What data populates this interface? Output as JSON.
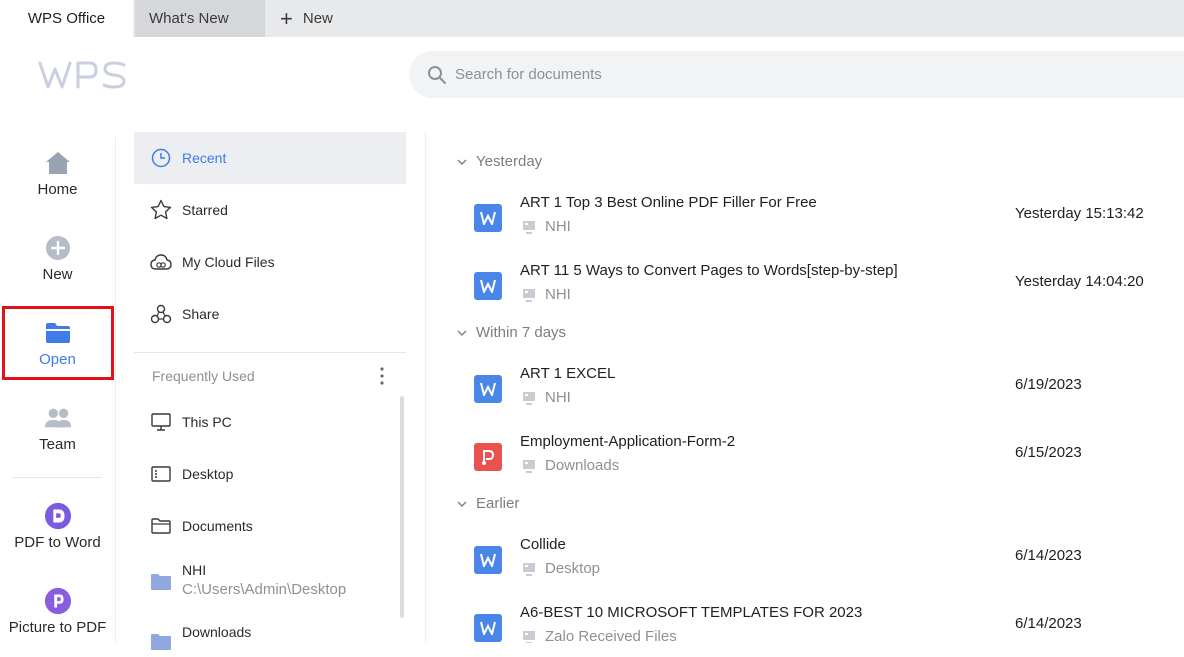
{
  "tabs": {
    "home": "WPS Office",
    "whats_new": "What's New",
    "new": "New"
  },
  "search": {
    "placeholder": "Search for documents"
  },
  "leftnav": [
    {
      "label": "Home",
      "icon": "home-icon"
    },
    {
      "label": "New",
      "icon": "plus-circle-icon"
    },
    {
      "label": "Open",
      "icon": "folder-icon",
      "active": true
    },
    {
      "label": "Team",
      "icon": "team-icon"
    },
    {
      "label": "PDF to Word",
      "icon": "pdf-to-word-icon"
    },
    {
      "label": "Picture to PDF",
      "icon": "picture-to-pdf-icon"
    }
  ],
  "col2": {
    "items": [
      {
        "label": "Recent",
        "icon": "clock-icon",
        "active": true
      },
      {
        "label": "Starred",
        "icon": "star-icon"
      },
      {
        "label": "My Cloud Files",
        "icon": "cloud-icon"
      },
      {
        "label": "Share",
        "icon": "share-icon"
      }
    ],
    "frequently_used_label": "Frequently Used",
    "locations": [
      {
        "label": "This PC",
        "icon": "monitor-icon"
      },
      {
        "label": "Desktop",
        "icon": "desktop-icon"
      },
      {
        "label": "Documents",
        "icon": "folder-outline-icon"
      },
      {
        "label": "NHI",
        "path": "C:\\Users\\Admin\\Desktop",
        "icon": "folder-filled-icon"
      },
      {
        "label": "Downloads",
        "icon": "folder-filled-icon"
      }
    ]
  },
  "groups": [
    {
      "label": "Yesterday"
    },
    {
      "label": "Within 7 days"
    },
    {
      "label": "Earlier"
    }
  ],
  "files": [
    {
      "name": "ART 1 Top 3 Best Online PDF Filler For Free",
      "location": "NHI",
      "date": "Yesterday 15:13:42",
      "type": "word"
    },
    {
      "name": "ART 11 5 Ways to Convert Pages to Words[step-by-step]",
      "location": "NHI",
      "date": "Yesterday 14:04:20",
      "type": "word"
    },
    {
      "name": "ART 1 EXCEL",
      "location": "NHI",
      "date": "6/19/2023",
      "type": "word"
    },
    {
      "name": "Employment-Application-Form-2",
      "location": "Downloads",
      "date": "6/15/2023",
      "type": "pdf"
    },
    {
      "name": "Collide",
      "location": "Desktop",
      "date": "6/14/2023",
      "type": "word"
    },
    {
      "name": "A6-BEST 10 MICROSOFT TEMPLATES FOR 2023",
      "location": "Zalo Received Files",
      "date": "6/14/2023",
      "type": "word"
    }
  ],
  "colors": {
    "accent": "#3f7be9",
    "word": "#4a86e8",
    "pdf": "#e8524f",
    "highlight": "#e3101b"
  }
}
